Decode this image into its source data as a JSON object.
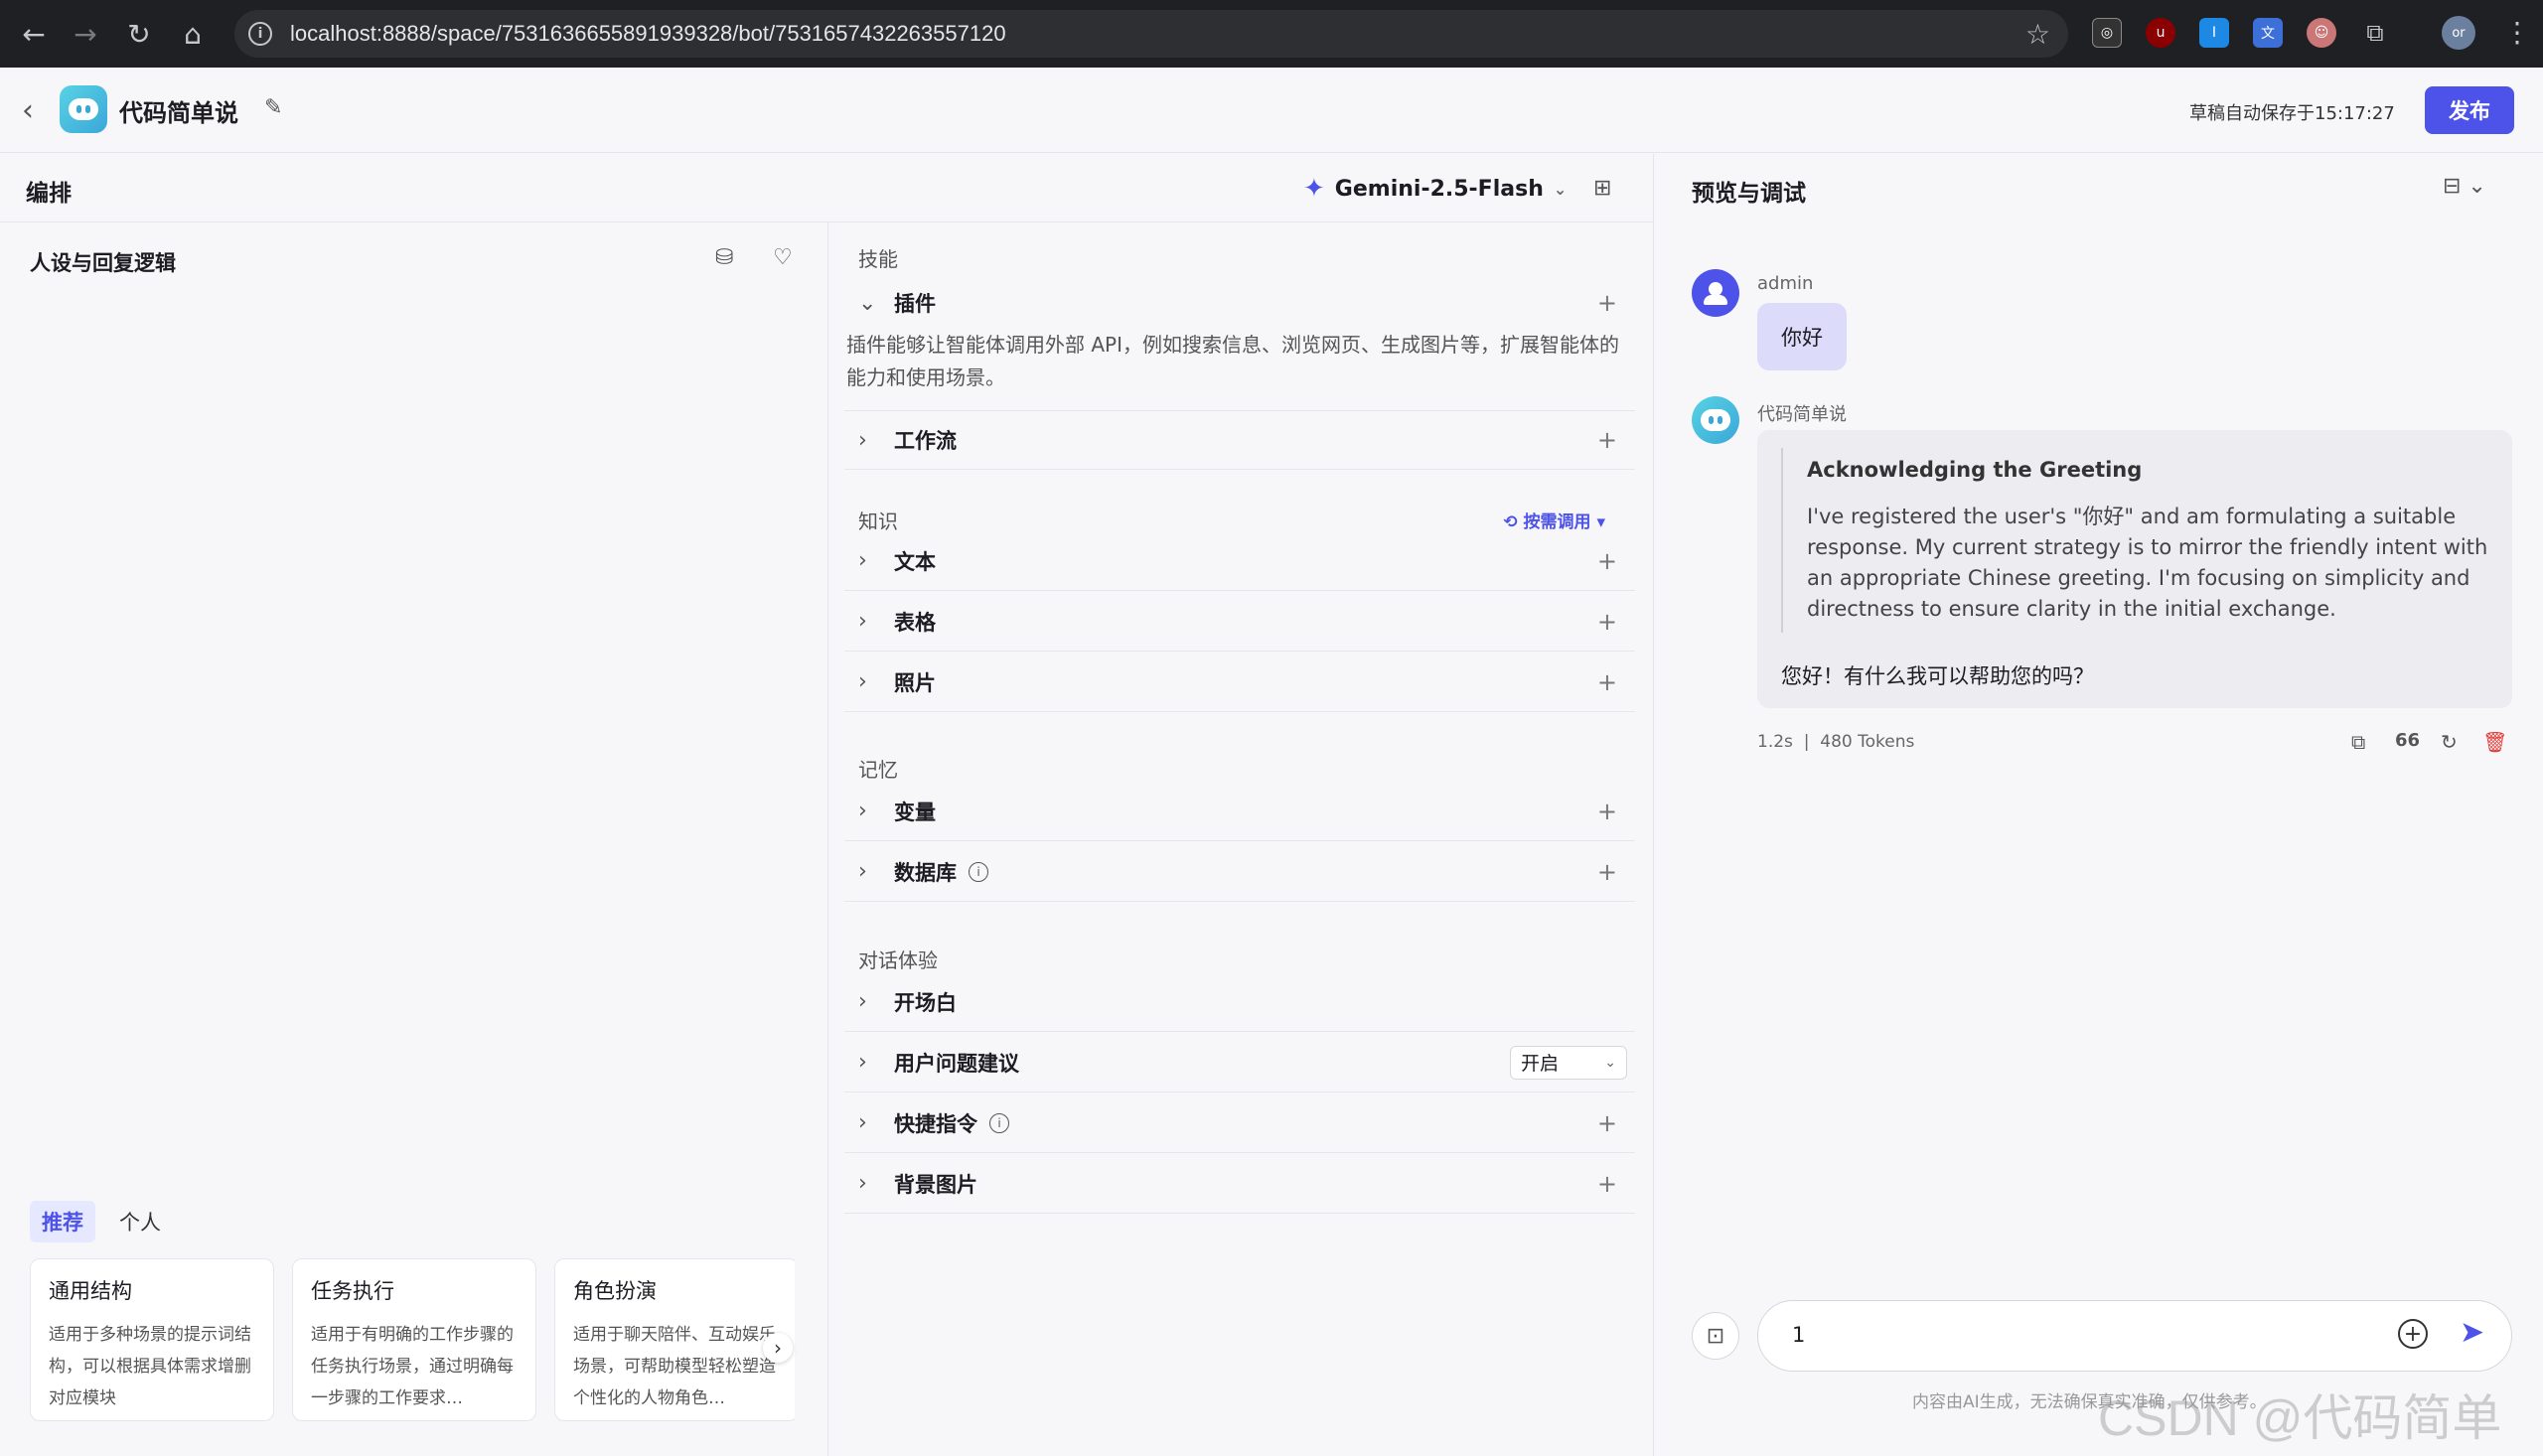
{
  "browser": {
    "url": "localhost:8888/space/7531636655891939328/bot/7531657432263557120",
    "profile_initials": "or"
  },
  "header": {
    "bot_name": "代码简单说",
    "autosave": "草稿自动保存于15:17:27",
    "publish_label": "发布"
  },
  "editor": {
    "title": "编排",
    "model": "Gemini-2.5-Flash",
    "persona_title": "人设与回复逻辑",
    "template_tabs": [
      "推荐",
      "个人"
    ],
    "templates": [
      {
        "title": "通用结构",
        "desc": "适用于多种场景的提示词结构，可以根据具体需求增删对应模块"
      },
      {
        "title": "任务执行",
        "desc": "适用于有明确的工作步骤的任务执行场景，通过明确每一步骤的工作要求…"
      },
      {
        "title": "角色扮演",
        "desc": "适用于聊天陪伴、互动娱乐场景，可帮助模型轻松塑造个性化的人物角色…"
      }
    ]
  },
  "skills": {
    "skills_label": "技能",
    "plugin_label": "插件",
    "plugin_desc": "插件能够让智能体调用外部 API，例如搜索信息、浏览网页、生成图片等，扩展智能体的能力和使用场景。",
    "workflow_label": "工作流",
    "knowledge_label": "知识",
    "on_demand": "按需调用",
    "text_label": "文本",
    "table_label": "表格",
    "photo_label": "照片",
    "memory_label": "记忆",
    "variable_label": "变量",
    "database_label": "数据库",
    "dialog_label": "对话体验",
    "opening_label": "开场白",
    "suggest_label": "用户问题建议",
    "suggest_value": "开启",
    "shortcut_label": "快捷指令",
    "bg_label": "背景图片"
  },
  "preview": {
    "title": "预览与调试",
    "user_name": "admin",
    "user_msg": "你好",
    "bot_name": "代码简单说",
    "thought_title": "Acknowledging the Greeting",
    "thought_body": "I've registered the user's \"你好\" and am formulating a suitable response. My current strategy is to mirror the friendly intent with an appropriate Chinese greeting. I'm focusing on simplicity and directness to ensure clarity in the initial exchange.",
    "reply": "您好！有什么我可以帮助您的吗？",
    "latency": "1.2s",
    "tokens": "480 Tokens",
    "quote_label": "66",
    "input_value": "1",
    "disclaimer": "内容由AI生成，无法确保真实准确，仅供参考。"
  },
  "watermark": "CSDN @代码简单说",
  "colors": {
    "accent": "#4d53e8",
    "danger": "#e53935"
  }
}
